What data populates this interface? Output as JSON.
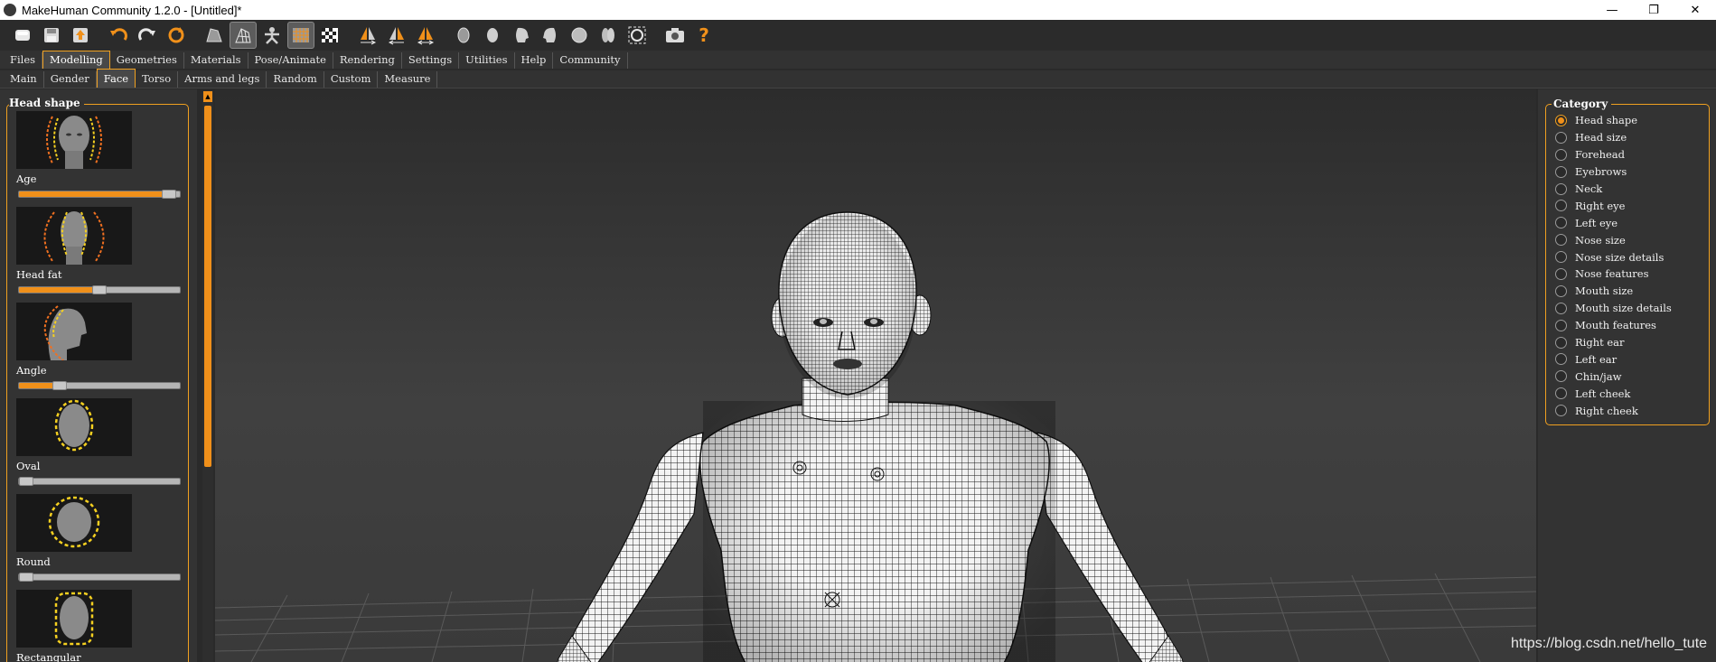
{
  "window": {
    "title": "MakeHuman Community 1.2.0 - [Untitled]*",
    "minimize": "—",
    "maximize": "❐",
    "close": "✕"
  },
  "toolbar": {
    "icons": [
      "new-file",
      "save",
      "export",
      "undo",
      "redo",
      "reset",
      "smooth",
      "wireframe",
      "pose",
      "grid",
      "background",
      "symmetry-right",
      "symmetry-left",
      "symmetry",
      "front-view",
      "back-view",
      "left-view",
      "right-view",
      "top-view",
      "bottom-view",
      "reset-camera",
      "screenshot",
      "help"
    ],
    "help_glyph": "?"
  },
  "menu": {
    "tabs": [
      "Files",
      "Modelling",
      "Geometries",
      "Materials",
      "Pose/Animate",
      "Rendering",
      "Settings",
      "Utilities",
      "Help",
      "Community"
    ],
    "active": "Modelling"
  },
  "submenu": {
    "tabs": [
      "Main",
      "Gender",
      "Face",
      "Torso",
      "Arms and legs",
      "Random",
      "Custom",
      "Measure"
    ],
    "active": "Face"
  },
  "left_panel": {
    "title": "Head shape",
    "morphs": [
      {
        "label": "Age",
        "value": 0.93
      },
      {
        "label": "Head fat",
        "value": 0.5
      },
      {
        "label": "Angle",
        "value": 0.25
      },
      {
        "label": "Oval",
        "value": 0.0
      },
      {
        "label": "Round",
        "value": 0.0
      },
      {
        "label": "Rectangular",
        "value": 0.0
      }
    ]
  },
  "category": {
    "title": "Category",
    "items": [
      "Head shape",
      "Head size",
      "Forehead",
      "Eyebrows",
      "Neck",
      "Right eye",
      "Left eye",
      "Nose size",
      "Nose size details",
      "Nose features",
      "Mouth size",
      "Mouth size details",
      "Mouth features",
      "Right ear",
      "Left ear",
      "Chin/jaw",
      "Left cheek",
      "Right cheek"
    ],
    "selected": "Head shape"
  },
  "watermark": "https://blog.csdn.net/hello_tute",
  "colors": {
    "accent": "#f0a020",
    "background": "#2a2a2a",
    "panel": "#333333",
    "mesh": "#f2f2f2"
  }
}
